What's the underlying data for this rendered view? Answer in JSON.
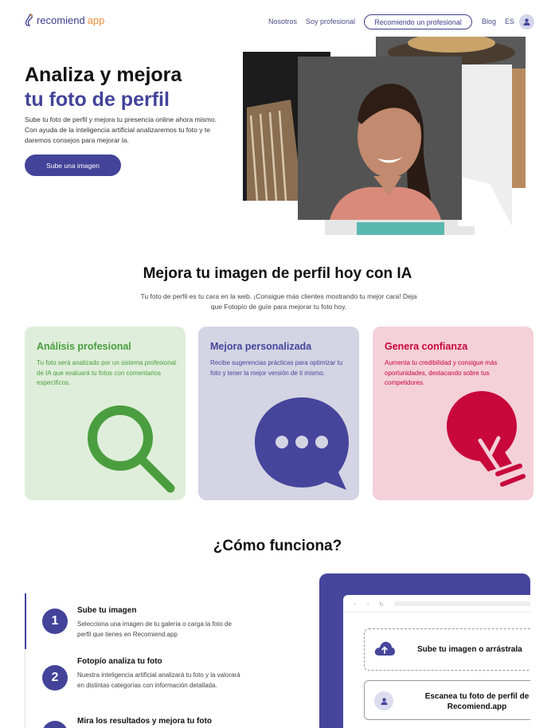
{
  "nav": {
    "logo_main": "recomiend",
    "logo_app": "app",
    "links": [
      "Nosotros",
      "Soy profesional"
    ],
    "cta": "Recomiendo un profesional",
    "blog": "Blog",
    "lang": "ES"
  },
  "hero": {
    "title_line1": "Analiza y mejora",
    "title_line2": "tu foto de perfil",
    "description": "Sube tu foto de perfil y mejora tu presencia online ahora mismo. Con ayuda de la inteligencia artificial analizaremos tu foto y te daremos consejos para mejorar la.",
    "button": "Sube una imagen"
  },
  "features": {
    "title": "Mejora tu imagen de perfil hoy con IA",
    "subtitle": "Tu foto de perfil es tu cara en la web. ¡Consigue más clientes mostrando tu mejor cara! Deja que Fotopío de guíe para mejorar tu foto hoy.",
    "cards": [
      {
        "title": "Análisis profesional",
        "text": "Tu foto será analizado por un sistema profesional de IA que evaluará tu fotos con comentarios específicos.",
        "icon": "magnifier-icon",
        "bg": "#dfeeda",
        "accent": "#4a9e3f"
      },
      {
        "title": "Mejora personalizada",
        "text": "Recibe sugerencias prácticas para optimizar tu foto y tener la mejor versión de ti mismo.",
        "icon": "chat-bubble-icon",
        "bg": "#d4d4e4",
        "accent": "#45459c"
      },
      {
        "title": "Genera confianza",
        "text": "Aumenta tu credibilidad y consigue más oportunidades, destacando sobre tus competidores.",
        "icon": "lightbulb-icon",
        "bg": "#f4d0d9",
        "accent": "#c8073b"
      }
    ]
  },
  "how": {
    "title": "¿Cómo funciona?",
    "steps": [
      {
        "num": "1",
        "title": "Sube tu imagen",
        "text": "Selecciona una imagen de tu galería o carga la foto de perfil que tienes en Recomiend.app"
      },
      {
        "num": "2",
        "title": "Fotopío analiza tu foto",
        "text": "Nuestra inteligencia artificial analizará tu foto y la valorará en distintas categorías con información detallada."
      },
      {
        "num": "3",
        "title": "Mira los resultados y mejora tu foto",
        "text": ""
      }
    ],
    "mock": {
      "upload": "Sube tu imagen o arrástrala",
      "scan": "Escanea tu foto de perfil de Recomiend.app"
    }
  },
  "colors": {
    "brand": "#43439a",
    "accent_orange": "#f08a3a"
  }
}
